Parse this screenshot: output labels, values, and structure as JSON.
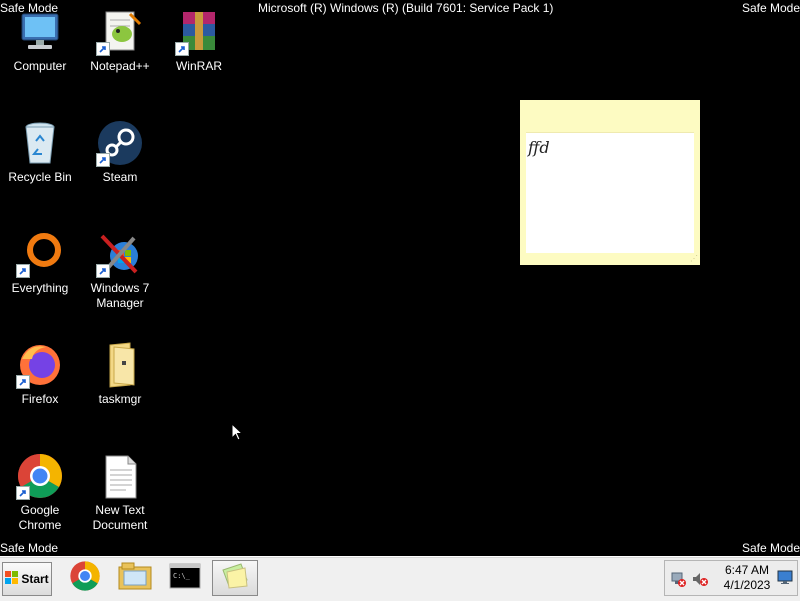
{
  "screen": {
    "safe_mode_label": "Safe Mode",
    "build_text": "Microsoft (R) Windows (R) (Build 7601: Service Pack 1)"
  },
  "desktop_icons": [
    {
      "label": "Computer"
    },
    {
      "label": "Notepad++"
    },
    {
      "label": "WinRAR"
    },
    {
      "label": "Recycle Bin"
    },
    {
      "label": "Steam"
    },
    {
      "label": "Everything"
    },
    {
      "label": "Windows 7\nManager"
    },
    {
      "label": "Firefox"
    },
    {
      "label": "taskmgr"
    },
    {
      "label": "Google\nChrome"
    },
    {
      "label": "New Text\nDocument"
    }
  ],
  "sticky_note": {
    "text": "ffd"
  },
  "taskbar": {
    "start_label": "Start",
    "pinned": [
      "chrome-icon",
      "explorer-icon",
      "cmd-icon",
      "sticky-notes-icon"
    ],
    "clock_time": "6:47 AM",
    "clock_date": "4/1/2023"
  }
}
